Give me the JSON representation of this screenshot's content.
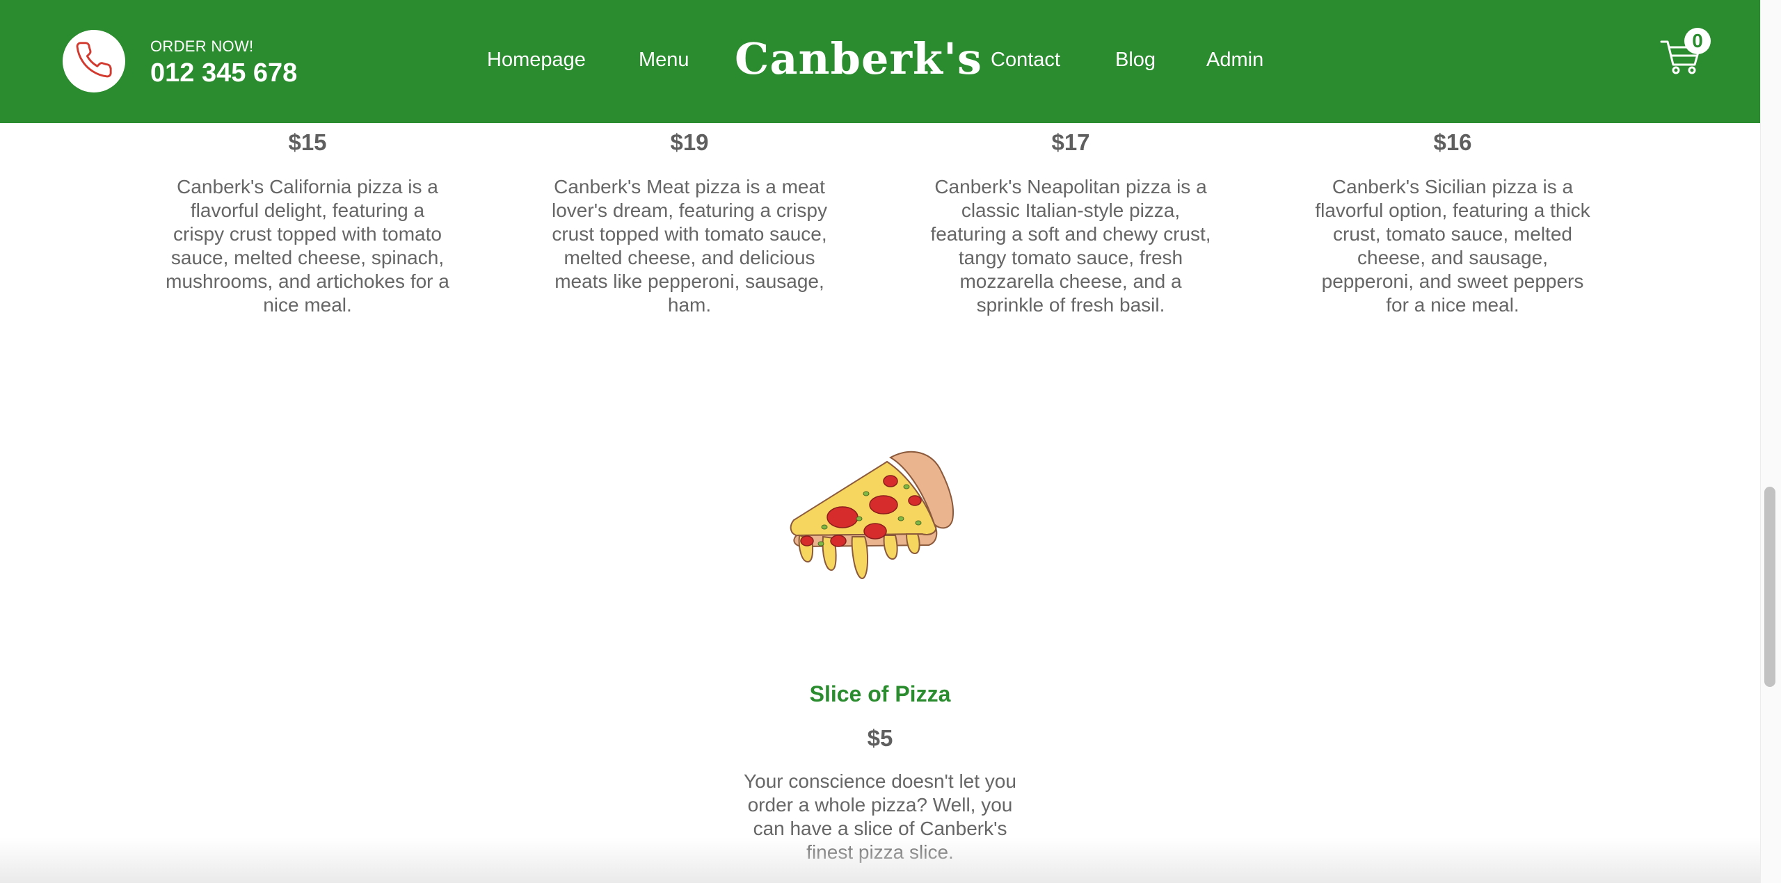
{
  "header": {
    "order_label": "ORDER NOW!",
    "phone": "012 345 678",
    "brand": "Canberk's",
    "nav": {
      "homepage": "Homepage",
      "menu": "Menu",
      "contact": "Contact",
      "blog": "Blog",
      "admin": "Admin"
    },
    "cart_count": "0",
    "icons": {
      "phone": "phone-icon",
      "cart": "cart-icon"
    }
  },
  "products": [
    {
      "price": "$15",
      "description": "Canberk's California pizza is a flavorful delight, featuring a crispy crust topped with tomato sauce, melted cheese, spinach, mushrooms, and artichokes for a nice meal."
    },
    {
      "price": "$19",
      "description": "Canberk's Meat pizza is a meat lover's dream, featuring a crispy crust topped with tomato sauce, melted cheese, and delicious meats like pepperoni, sausage, ham."
    },
    {
      "price": "$17",
      "description": "Canberk's Neapolitan pizza is a classic Italian-style pizza, featuring a soft and chewy crust, tangy tomato sauce, fresh mozzarella cheese, and a sprinkle of fresh basil."
    },
    {
      "price": "$16",
      "description": "Canberk's Sicilian pizza is a flavorful option, featuring a thick crust, tomato sauce, melted cheese, and sausage, pepperoni, and sweet peppers for a nice meal."
    }
  ],
  "featured": {
    "name": "Slice of Pizza",
    "price": "$5",
    "description": "Your conscience doesn't let you order a whole pizza? Well, you can have a slice of Canberk's finest pizza slice.",
    "image_icon": "pizza-slice-icon"
  },
  "colors": {
    "primary_green": "#2a8c2e",
    "text_gray": "#666666",
    "phone_red": "#d23a2f"
  }
}
